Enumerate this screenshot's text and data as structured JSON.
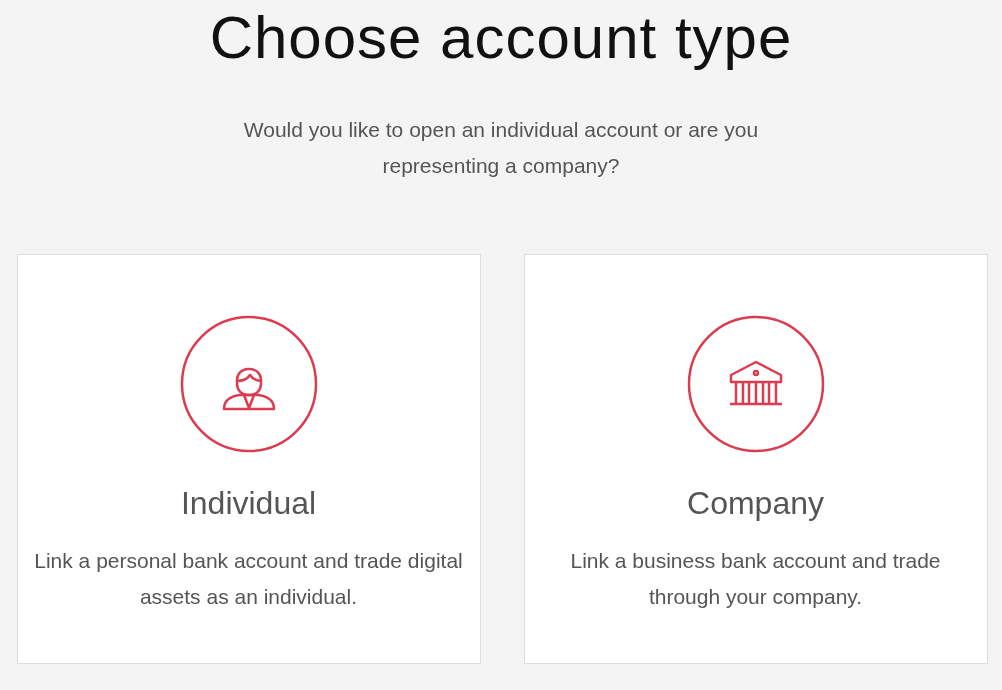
{
  "heading": "Choose account type",
  "subtitle": "Would you like to open an individual account or are you representing a company?",
  "options": [
    {
      "kind": "person",
      "title": "Individual",
      "description": "Link a personal bank account and trade digital assets as an individual."
    },
    {
      "kind": "bank",
      "title": "Company",
      "description": "Link a business bank account and trade through your company."
    }
  ]
}
